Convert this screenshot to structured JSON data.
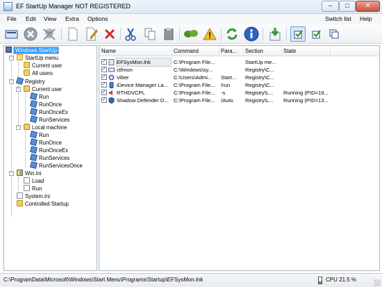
{
  "window": {
    "title": "EF StartUp Manager NOT REGISTERED"
  },
  "menu": {
    "file": "File",
    "edit": "Edit",
    "view": "View",
    "extra": "Extra",
    "options": "Options",
    "switch_list": "Switch list",
    "help": "Help"
  },
  "toolbar": {
    "icons": [
      "open-icon",
      "stop-icon",
      "skull-icon",
      "new-document-icon",
      "edit-icon",
      "delete-icon",
      "cut-icon",
      "copy-icon",
      "paste-icon",
      "leaves-icon",
      "warning-icon",
      "refresh-icon",
      "info-icon",
      "download-icon",
      "checklist-icon",
      "check-icon",
      "windows-icon"
    ]
  },
  "tree": {
    "root": "Windows StartUp",
    "startup_menu": "StartUp menu",
    "current_user_1": "Current user",
    "all_users": "All users",
    "registry": "Registry",
    "current_user_2": "Current user",
    "run_1": "Run",
    "runonce_1": "RunOnce",
    "runonceex_1": "RunOnceEx",
    "runservices_1": "RunServices",
    "local_machine": "Local machine",
    "run_2": "Run",
    "runonce_2": "RunOnce",
    "runonceex_2": "RunOnceEx",
    "runservices_2": "RunServices",
    "runservicesonce": "RunServicesOnce",
    "winini": "Win.ini",
    "load": "Load",
    "run_3": "Run",
    "systemini": "System.ini",
    "controlled_startup": "Controlled Startup"
  },
  "list": {
    "columns": [
      "Name",
      "Command",
      "Para...",
      "Section",
      "State"
    ],
    "rows": [
      {
        "name": "EFSysMon.lnk",
        "command": "C:\\Program File...",
        "params": "",
        "section": "StartUp me...",
        "state": "",
        "icon": "file-icon",
        "checked": true
      },
      {
        "name": "ctfmon",
        "command": "C:\\Windows\\sy...",
        "params": "",
        "section": "Registry\\C...",
        "state": "",
        "icon": "keyboard-icon",
        "checked": true
      },
      {
        "name": "Viber",
        "command": "C:\\Users\\Admi...",
        "params": "Start...",
        "section": "Registry\\C...",
        "state": "",
        "icon": "viber-icon",
        "checked": true
      },
      {
        "name": "iDevice Manager La...",
        "command": "C:\\Program File...",
        "params": "/run",
        "section": "Registry\\C...",
        "state": "",
        "icon": "device-icon",
        "checked": true
      },
      {
        "name": "RTHDVCPL",
        "command": "C:\\Program File...",
        "params": "-s",
        "section": "Registry\\L...",
        "state": "Running (PID=19...",
        "icon": "speaker-icon",
        "checked": true
      },
      {
        "name": "Shadow Defender D...",
        "command": "C:\\Program File...",
        "params": "/Auto",
        "section": "Registry\\L...",
        "state": "Running (PID=13...",
        "icon": "shield-icon",
        "checked": true
      }
    ]
  },
  "status": {
    "path": "C:\\ProgramData\\Microsoft\\Windows\\Start Menu\\Programs\\Startup\\EFSysMon.lnk",
    "cpu": "CPU  21.5 %"
  }
}
